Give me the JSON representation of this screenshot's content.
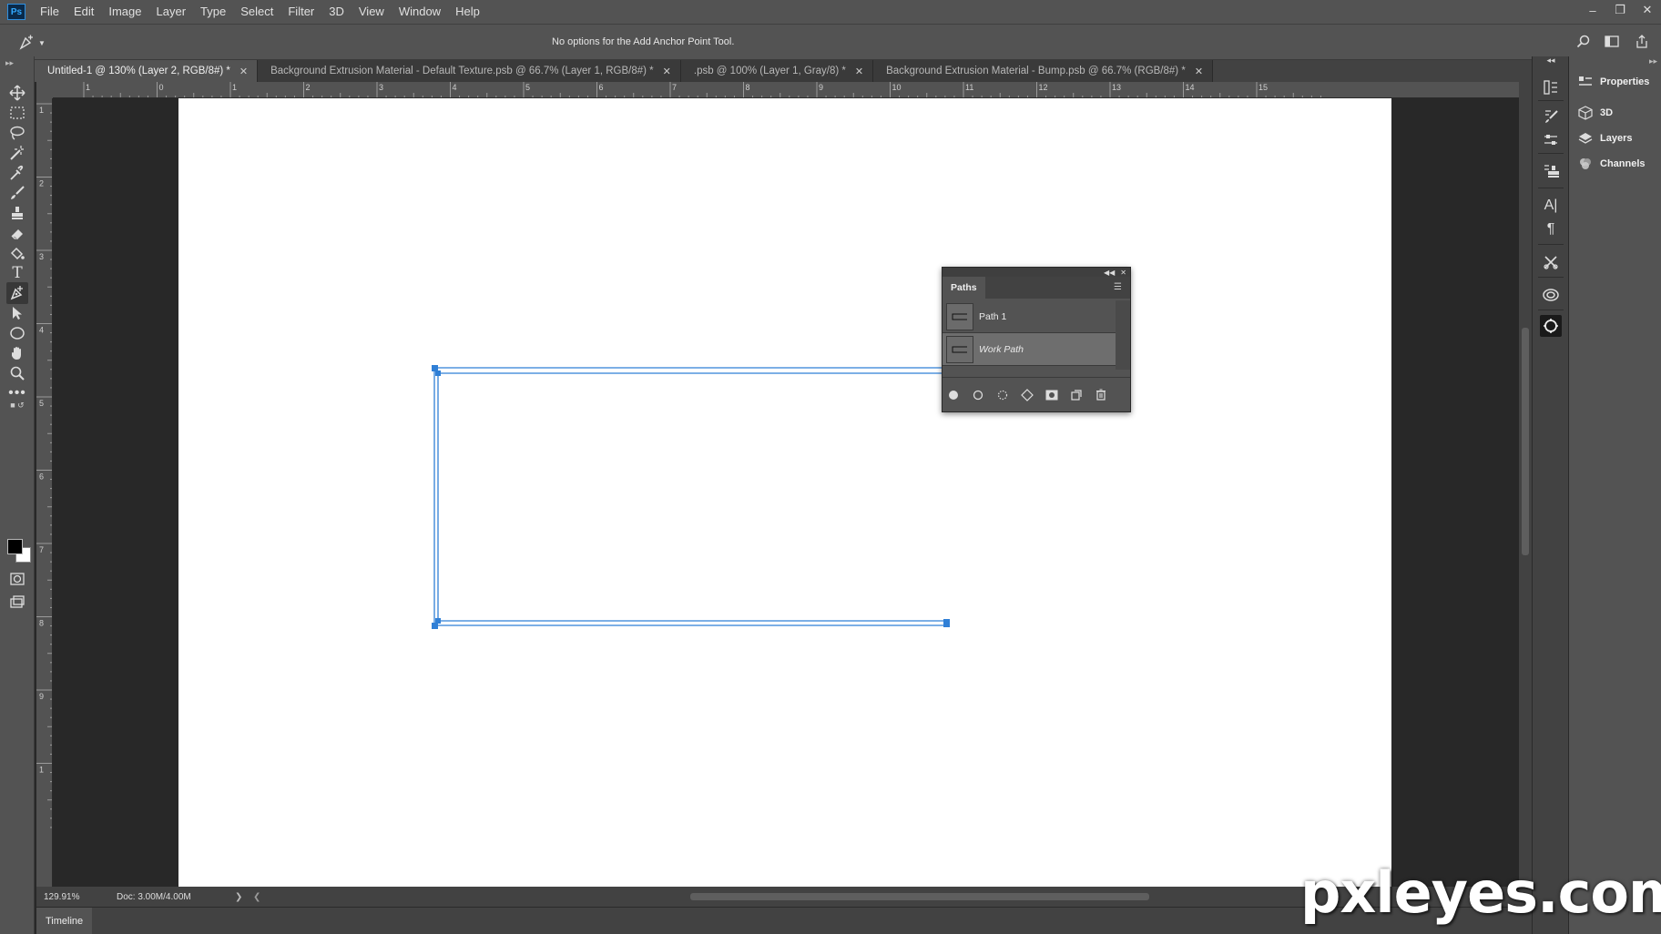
{
  "app": {
    "logo_text": "Ps",
    "menu": [
      "File",
      "Edit",
      "Image",
      "Layer",
      "Type",
      "Select",
      "Filter",
      "3D",
      "View",
      "Window",
      "Help"
    ]
  },
  "options_bar": {
    "message": "No options for the Add Anchor Point Tool."
  },
  "tabs": [
    {
      "label": "Untitled-1 @ 130% (Layer 2, RGB/8#) *",
      "active": true
    },
    {
      "label": "Background Extrusion Material - Default Texture.psb @ 66.7% (Layer 1, RGB/8#) *",
      "active": false
    },
    {
      "label": ".psb @ 100% (Layer 1, Gray/8) *",
      "active": false
    },
    {
      "label": "Background Extrusion Material - Bump.psb @ 66.7% (RGB/8#) *",
      "active": false
    }
  ],
  "rulers": {
    "top_labels": [
      "1",
      "0",
      "1",
      "2",
      "3",
      "4",
      "5",
      "6",
      "7",
      "8",
      "9",
      "10",
      "11",
      "12",
      "13",
      "14",
      "15"
    ],
    "left_labels": [
      "1",
      "2",
      "3",
      "4",
      "5",
      "6",
      "7",
      "8",
      "9",
      "1"
    ]
  },
  "paths_panel": {
    "tab_label": "Paths",
    "items": [
      {
        "name": "Path 1",
        "selected": false
      },
      {
        "name": "Work Path",
        "selected": true
      }
    ]
  },
  "status": {
    "zoom": "129.91%",
    "doc": "Doc: 3.00M/4.00M"
  },
  "timeline": {
    "label": "Timeline"
  },
  "panels": [
    {
      "label": "Properties"
    },
    {
      "label": "3D"
    },
    {
      "label": "Layers"
    },
    {
      "label": "Channels"
    }
  ],
  "colors": {
    "path_stroke": "#2f7fd6",
    "foreground": "#000000",
    "background": "#ffffff"
  },
  "watermark": "pxleyes.com"
}
